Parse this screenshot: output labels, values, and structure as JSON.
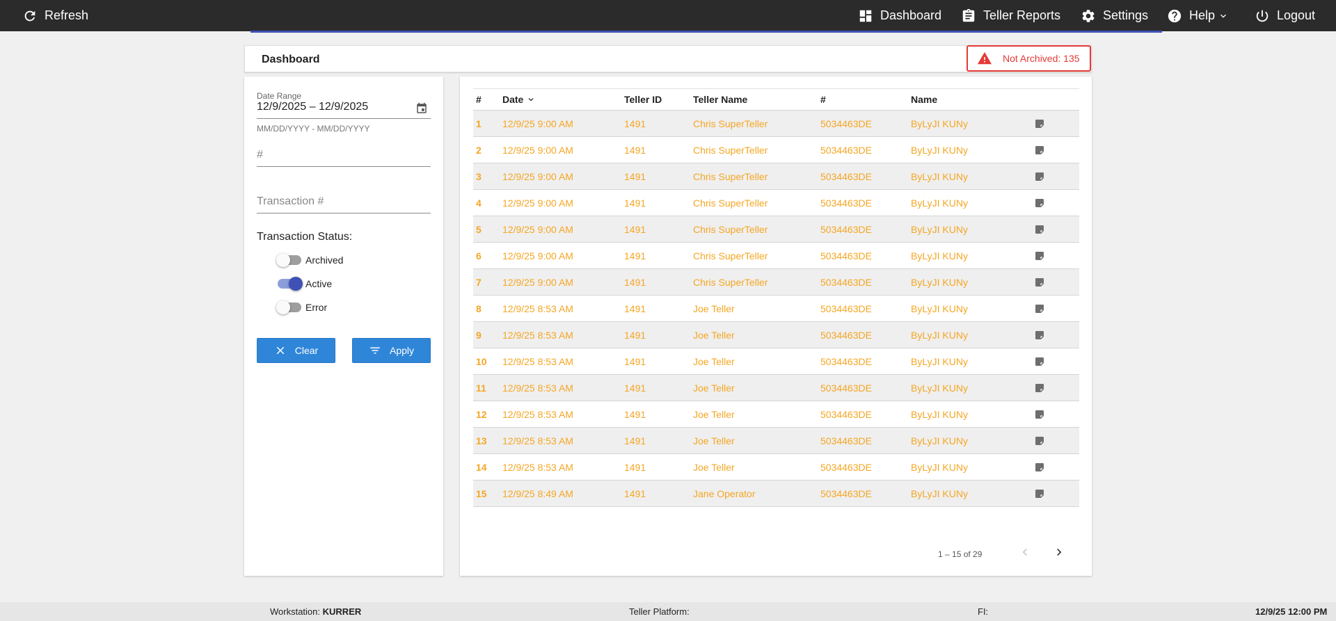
{
  "topbar": {
    "refresh": "Refresh",
    "dashboard": "Dashboard",
    "teller_reports": "Teller Reports",
    "settings": "Settings",
    "help": "Help",
    "logout": "Logout"
  },
  "header": {
    "title": "Dashboard",
    "alert": "Not Archived: 135"
  },
  "filters": {
    "date_range_label": "Date Range",
    "date_range_value": "12/9/2025 – 12/9/2025",
    "date_range_hint": "MM/DD/YYYY - MM/DD/YYYY",
    "number_placeholder": "#",
    "transaction_placeholder": "Transaction #",
    "status_label": "Transaction Status:",
    "toggles": [
      {
        "label": "Archived",
        "on": false
      },
      {
        "label": "Active",
        "on": true
      },
      {
        "label": "Error",
        "on": false
      }
    ],
    "clear_label": "Clear",
    "apply_label": "Apply"
  },
  "table": {
    "headers": [
      "#",
      "Date",
      "Teller ID",
      "Teller Name",
      "#",
      "Name"
    ],
    "rows": [
      [
        "1",
        "12/9/25 9:00 AM",
        "1491",
        "Chris SuperTeller",
        "5034463DE",
        "ByLyJI KUNy"
      ],
      [
        "2",
        "12/9/25 9:00 AM",
        "1491",
        "Chris SuperTeller",
        "5034463DE",
        "ByLyJI KUNy"
      ],
      [
        "3",
        "12/9/25 9:00 AM",
        "1491",
        "Chris SuperTeller",
        "5034463DE",
        "ByLyJI KUNy"
      ],
      [
        "4",
        "12/9/25 9:00 AM",
        "1491",
        "Chris SuperTeller",
        "5034463DE",
        "ByLyJI KUNy"
      ],
      [
        "5",
        "12/9/25 9:00 AM",
        "1491",
        "Chris SuperTeller",
        "5034463DE",
        "ByLyJI KUNy"
      ],
      [
        "6",
        "12/9/25 9:00 AM",
        "1491",
        "Chris SuperTeller",
        "5034463DE",
        "ByLyJI KUNy"
      ],
      [
        "7",
        "12/9/25 9:00 AM",
        "1491",
        "Chris SuperTeller",
        "5034463DE",
        "ByLyJI KUNy"
      ],
      [
        "8",
        "12/9/25 8:53 AM",
        "1491",
        "Joe Teller",
        "5034463DE",
        "ByLyJI KUNy"
      ],
      [
        "9",
        "12/9/25 8:53 AM",
        "1491",
        "Joe Teller",
        "5034463DE",
        "ByLyJI KUNy"
      ],
      [
        "10",
        "12/9/25 8:53 AM",
        "1491",
        "Joe Teller",
        "5034463DE",
        "ByLyJI KUNy"
      ],
      [
        "11",
        "12/9/25 8:53 AM",
        "1491",
        "Joe Teller",
        "5034463DE",
        "ByLyJI KUNy"
      ],
      [
        "12",
        "12/9/25 8:53 AM",
        "1491",
        "Joe Teller",
        "5034463DE",
        "ByLyJI KUNy"
      ],
      [
        "13",
        "12/9/25 8:53 AM",
        "1491",
        "Joe Teller",
        "5034463DE",
        "ByLyJI KUNy"
      ],
      [
        "14",
        "12/9/25 8:53 AM",
        "1491",
        "Joe Teller",
        "5034463DE",
        "ByLyJI KUNy"
      ],
      [
        "15",
        "12/9/25 8:49 AM",
        "1491",
        "Jane Operator",
        "5034463DE",
        "ByLyJI KUNy"
      ]
    ],
    "pager": "1 – 15 of 29"
  },
  "statusbar": {
    "workstation_label": "Workstation:",
    "workstation_value": "KURRER",
    "platform_label": "Teller Platform:",
    "fi_label": "FI:",
    "datetime": "12/9/25 12:00 PM"
  },
  "colors": {
    "topbar": "#2b2b2b",
    "accent": "#3f51b5",
    "row_text": "#f5a623",
    "alert": "#e53935",
    "button": "#2f86d8"
  }
}
